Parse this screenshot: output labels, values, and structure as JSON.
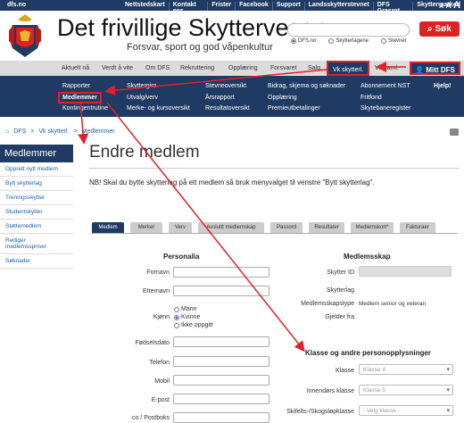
{
  "topbar": {
    "site": "dfs.no",
    "links": [
      "Nettstedskart",
      "Kontakt oss",
      "Frister",
      "Facebook",
      "Support",
      "Landsskytterstevnet",
      "DFS Grasrot",
      "Skyttermarked"
    ],
    "text_sizes": [
      "A",
      "A",
      "A"
    ]
  },
  "header": {
    "title": "Det frivillige Skyttervesen",
    "subtitle": "Forsvar, sport og god våpenkultur",
    "search_button": "Søk",
    "search_scopes": [
      "DFS.no",
      "Skytterlagene",
      "Stevner"
    ]
  },
  "mainnav": {
    "items": [
      "Aktuelt nå",
      "Verdt å vite",
      "Om DFS",
      "Rekruttering",
      "Opplæring",
      "Forsvaret",
      "Salg",
      "Vk skytterl.",
      "Vk saml."
    ],
    "mitt": "Mitt DFS"
  },
  "submenu": {
    "col1": [
      "Rapporter",
      "Medlemmer",
      "Kontingentrutine"
    ],
    "col2": [
      "Skyttergiro",
      "Utvalg/verv",
      "Merke- og kursoversikt"
    ],
    "col3": [
      "Stevneoversikt",
      "Årsrapport",
      "Resultatoversikt"
    ],
    "col4": [
      "Bidrag, skjema og søknader",
      "Opplæring",
      "Premieutbetalinger"
    ],
    "col5": [
      "Abonnement NST",
      "Fritfond",
      "Skytebaneregister"
    ],
    "help": "Hjelp!"
  },
  "breadcrumb": [
    "DFS",
    ">",
    "Vk skytterl.",
    ">",
    "Medlemmer"
  ],
  "sidebar": {
    "title": "Medlemmer",
    "items": [
      "Opprett nytt medlem",
      "Bytt skytterlag",
      "Treningsskytter",
      "Studentskytter",
      "Støttemedlem",
      "Rediger medlemsspriser",
      "Søknader"
    ]
  },
  "main": {
    "title": "Endre medlem",
    "notice": "NB! Skal du bytte skytterlag på ett medlem så bruk menyvalget til venstre \"Bytt skytterlag\".",
    "tabs": [
      "Medlem",
      "Merker",
      "Verv",
      "Avsluttt medlemskap",
      "Passord",
      "Resultater",
      "Medlemskort*",
      "Fakturaer"
    ]
  },
  "personalia": {
    "title": "Personalia",
    "fields": [
      "Fornavn",
      "Etternavn",
      "Kjønn",
      "Fødselsdato",
      "Telefon",
      "Mobil",
      "E-post",
      "co / Postboks"
    ],
    "gender_options": [
      "Mann",
      "Kvinne",
      "Ikke oppgitt"
    ],
    "gender_selected": "Kvinne"
  },
  "medlemsskap": {
    "title": "Medlemsskap",
    "labels": [
      "Skytter ID",
      "Skytterlag",
      "Medlemsskapstype",
      "Gjelder fra"
    ],
    "type_value": "Medlem senior og veteran"
  },
  "klasse": {
    "title": "Klasse og andre personopplysninger",
    "labels": [
      "Klasse",
      "Innendørs klasse",
      "Skifelts-/Skogsløpklasse"
    ],
    "values": [
      "Klasse 4",
      "Klasse 5",
      "- Velg klasse -"
    ]
  },
  "colors": {
    "navy": "#1f3b63",
    "highlight": "#e0202a",
    "search_button": "#dd2222",
    "link": "#1f5fa8"
  }
}
